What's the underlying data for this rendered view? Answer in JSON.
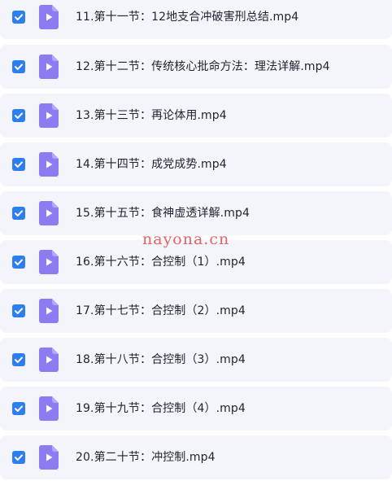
{
  "colors": {
    "row_background": "#f4f5fa",
    "checkbox": "#2b7ff0",
    "file_icon": "#8b7cf2",
    "watermark": "#e05454"
  },
  "files": [
    {
      "name": "11.第十一节：12地支合冲破害刑总结.mp4",
      "checked": true,
      "icon": "video-file-icon"
    },
    {
      "name": "12.第十二节：传统核心批命方法：理法详解.mp4",
      "checked": true,
      "icon": "video-file-icon"
    },
    {
      "name": "13.第十三节：再论体用.mp4",
      "checked": true,
      "icon": "video-file-icon"
    },
    {
      "name": "14.第十四节：成党成势.mp4",
      "checked": true,
      "icon": "video-file-icon"
    },
    {
      "name": "15.第十五节：食神虚透详解.mp4",
      "checked": true,
      "icon": "video-file-icon"
    },
    {
      "name": "16.第十六节：合控制（1）.mp4",
      "checked": true,
      "icon": "video-file-icon"
    },
    {
      "name": "17.第十七节：合控制（2）.mp4",
      "checked": true,
      "icon": "video-file-icon"
    },
    {
      "name": "18.第十八节：合控制（3）.mp4",
      "checked": true,
      "icon": "video-file-icon"
    },
    {
      "name": "19.第十九节：合控制（4）.mp4",
      "checked": true,
      "icon": "video-file-icon"
    },
    {
      "name": "20.第二十节：冲控制.mp4",
      "checked": true,
      "icon": "video-file-icon"
    }
  ],
  "watermark": "nayona.cn"
}
